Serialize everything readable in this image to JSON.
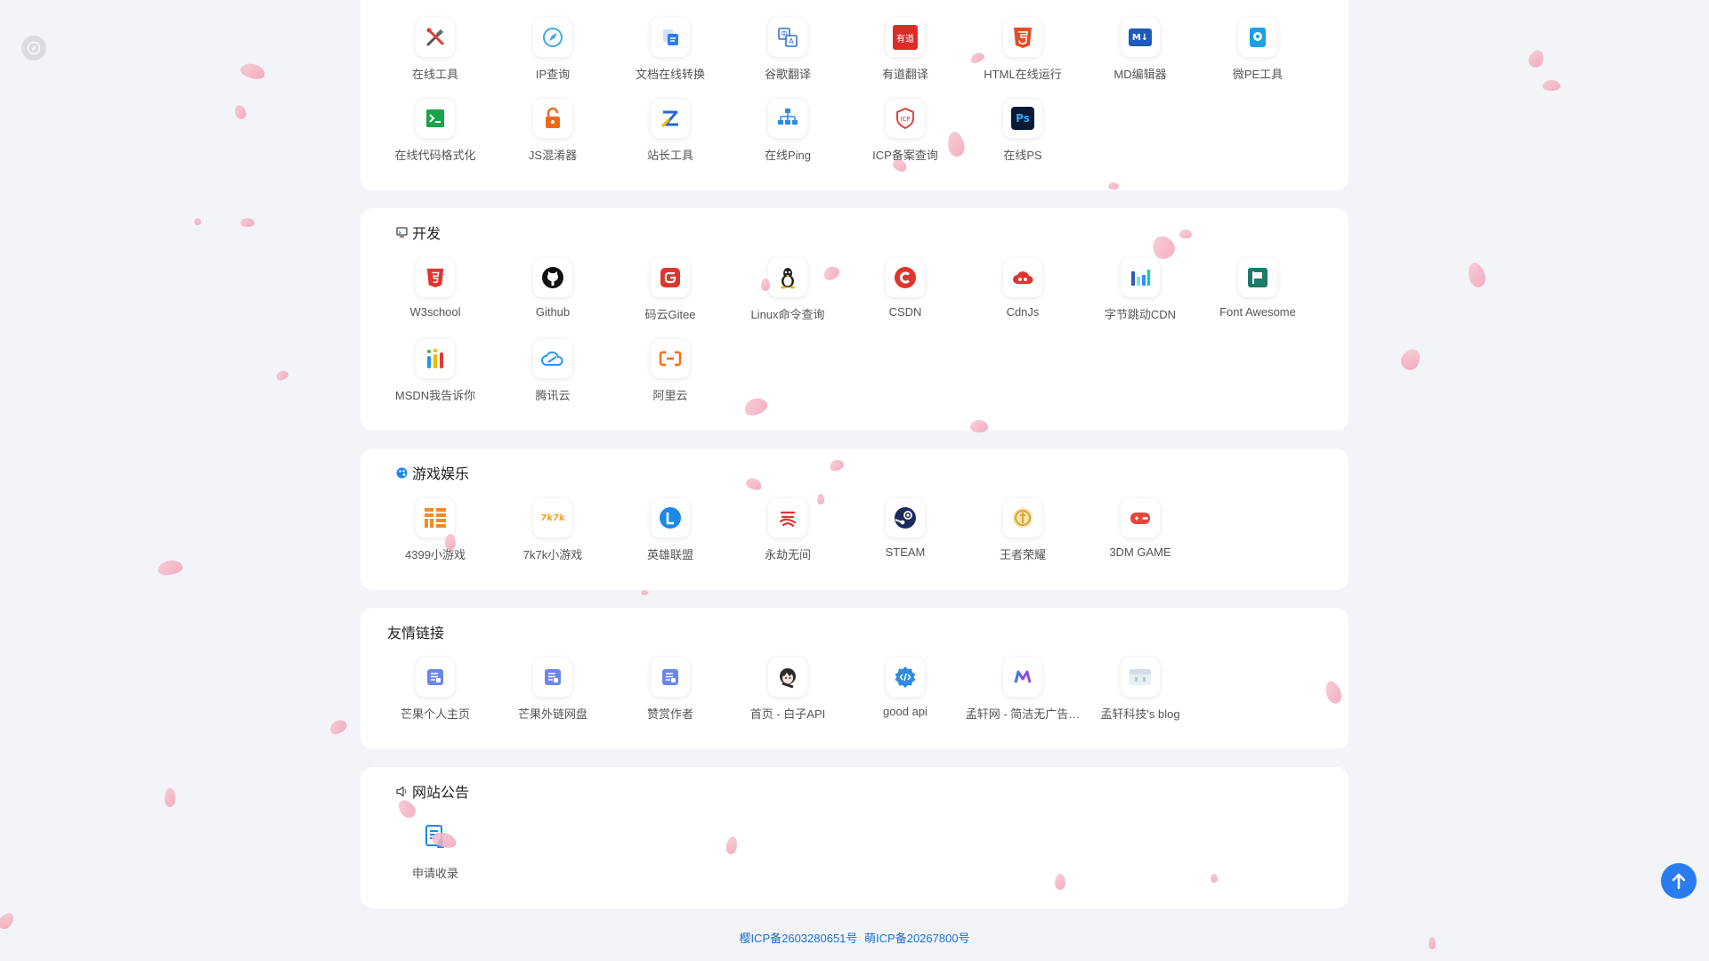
{
  "sections": {
    "tools": {
      "items": [
        "在线工具",
        "IP查询",
        "文档在线转换",
        "谷歌翻译",
        "有道翻译",
        "HTML在线运行",
        "MD编辑器",
        "微PE工具",
        "在线代码格式化",
        "JS混淆器",
        "站长工具",
        "在线Ping",
        "ICP备案查询",
        "在线PS"
      ]
    },
    "dev": {
      "title": "开发",
      "items": [
        "W3school",
        "Github",
        "码云Gitee",
        "Linux命令查询",
        "CSDN",
        "CdnJs",
        "字节跳动CDN",
        "Font Awesome",
        "MSDN我告诉你",
        "腾讯云",
        "阿里云"
      ]
    },
    "games": {
      "title": "游戏娱乐",
      "items": [
        "4399小游戏",
        "7k7k小游戏",
        "英雄联盟",
        "永劫无间",
        "STEAM",
        "王者荣耀",
        "3DM GAME"
      ]
    },
    "friends": {
      "title": "友情链接",
      "items": [
        "芒果个人主页",
        "芒果外链网盘",
        "赞赏作者",
        "首页 - 白子API",
        "good api",
        "孟轩网 - 简洁无广告…",
        "孟轩科技's blog"
      ]
    },
    "notice": {
      "title": "网站公告",
      "items": [
        "申请收录"
      ]
    }
  },
  "icon_text": {
    "youdao": "有道",
    "md": "M↓",
    "ps": "Ps",
    "icp": "ICP",
    "k7": "7k7k"
  },
  "footer": {
    "icp1": "樱ICP备2603280651号",
    "icp2": "萌ICP备20267800号"
  },
  "colors": {
    "accent": "#2a7cf0",
    "link": "#1a6fd6",
    "petal": "#f5b3c4"
  }
}
